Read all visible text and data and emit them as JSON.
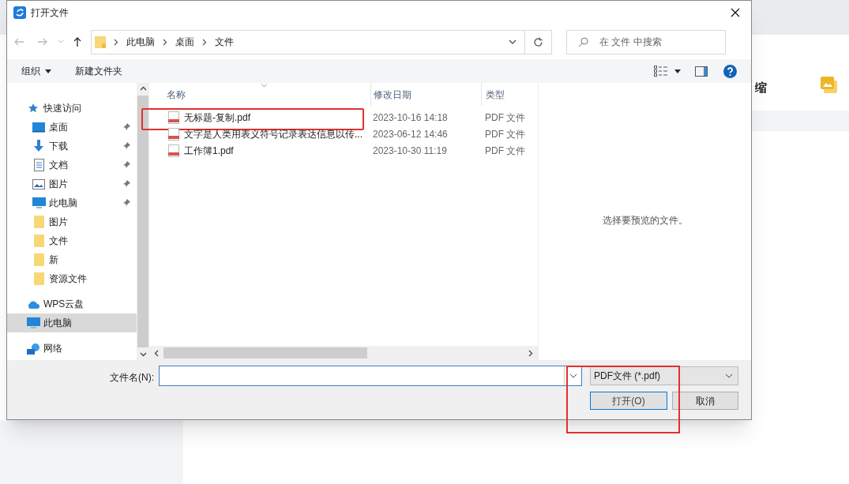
{
  "background_app": {
    "toolbar_label": "缩"
  },
  "window": {
    "title": "打开文件"
  },
  "address": {
    "path": [
      "此电脑",
      "桌面",
      "文件"
    ],
    "search_placeholder": "在 文件 中搜索"
  },
  "toolbar": {
    "organize": "组织",
    "new_folder": "新建文件夹"
  },
  "sidebar": {
    "items": [
      {
        "kind": "quick_access",
        "label": "快速访问",
        "pinned": false,
        "selected": false
      },
      {
        "kind": "desktop",
        "label": "桌面",
        "pinned": true,
        "selected": false
      },
      {
        "kind": "downloads",
        "label": "下载",
        "pinned": true,
        "selected": false
      },
      {
        "kind": "documents",
        "label": "文档",
        "pinned": true,
        "selected": false
      },
      {
        "kind": "pictures",
        "label": "图片",
        "pinned": true,
        "selected": false
      },
      {
        "kind": "computer",
        "label": "此电脑",
        "pinned": true,
        "selected": false
      },
      {
        "kind": "folder",
        "label": "图片",
        "pinned": false,
        "selected": false
      },
      {
        "kind": "folder",
        "label": "文件",
        "pinned": false,
        "selected": false
      },
      {
        "kind": "folder",
        "label": "新",
        "pinned": false,
        "selected": false
      },
      {
        "kind": "folder",
        "label": "资源文件",
        "pinned": false,
        "selected": false
      },
      {
        "kind": "cloud",
        "label": "WPS云盘",
        "pinned": false,
        "selected": false
      },
      {
        "kind": "computer_root",
        "label": "此电脑",
        "pinned": false,
        "selected": true
      },
      {
        "kind": "network",
        "label": "网络",
        "pinned": false,
        "selected": false
      }
    ]
  },
  "table": {
    "columns": [
      "名称",
      "修改日期",
      "类型"
    ],
    "rows": [
      {
        "name": "无标题-复制.pdf",
        "date": "2023-10-16 14:18",
        "type": "PDF 文件",
        "highlighted": true
      },
      {
        "name": "文字是人类用表义符号记录表达信息以传...",
        "date": "2023-06-12 14:46",
        "type": "PDF 文件",
        "highlighted": false
      },
      {
        "name": "工作簿1.pdf",
        "date": "2023-10-30 11:19",
        "type": "PDF 文件",
        "highlighted": false
      }
    ]
  },
  "preview": {
    "message": "选择要预览的文件。"
  },
  "footer": {
    "filename_label": "文件名(N):",
    "file_type": "PDF文件 (*.pdf)",
    "open_button": "打开(O)",
    "open_highlighted": true,
    "cancel_button": "取消"
  }
}
